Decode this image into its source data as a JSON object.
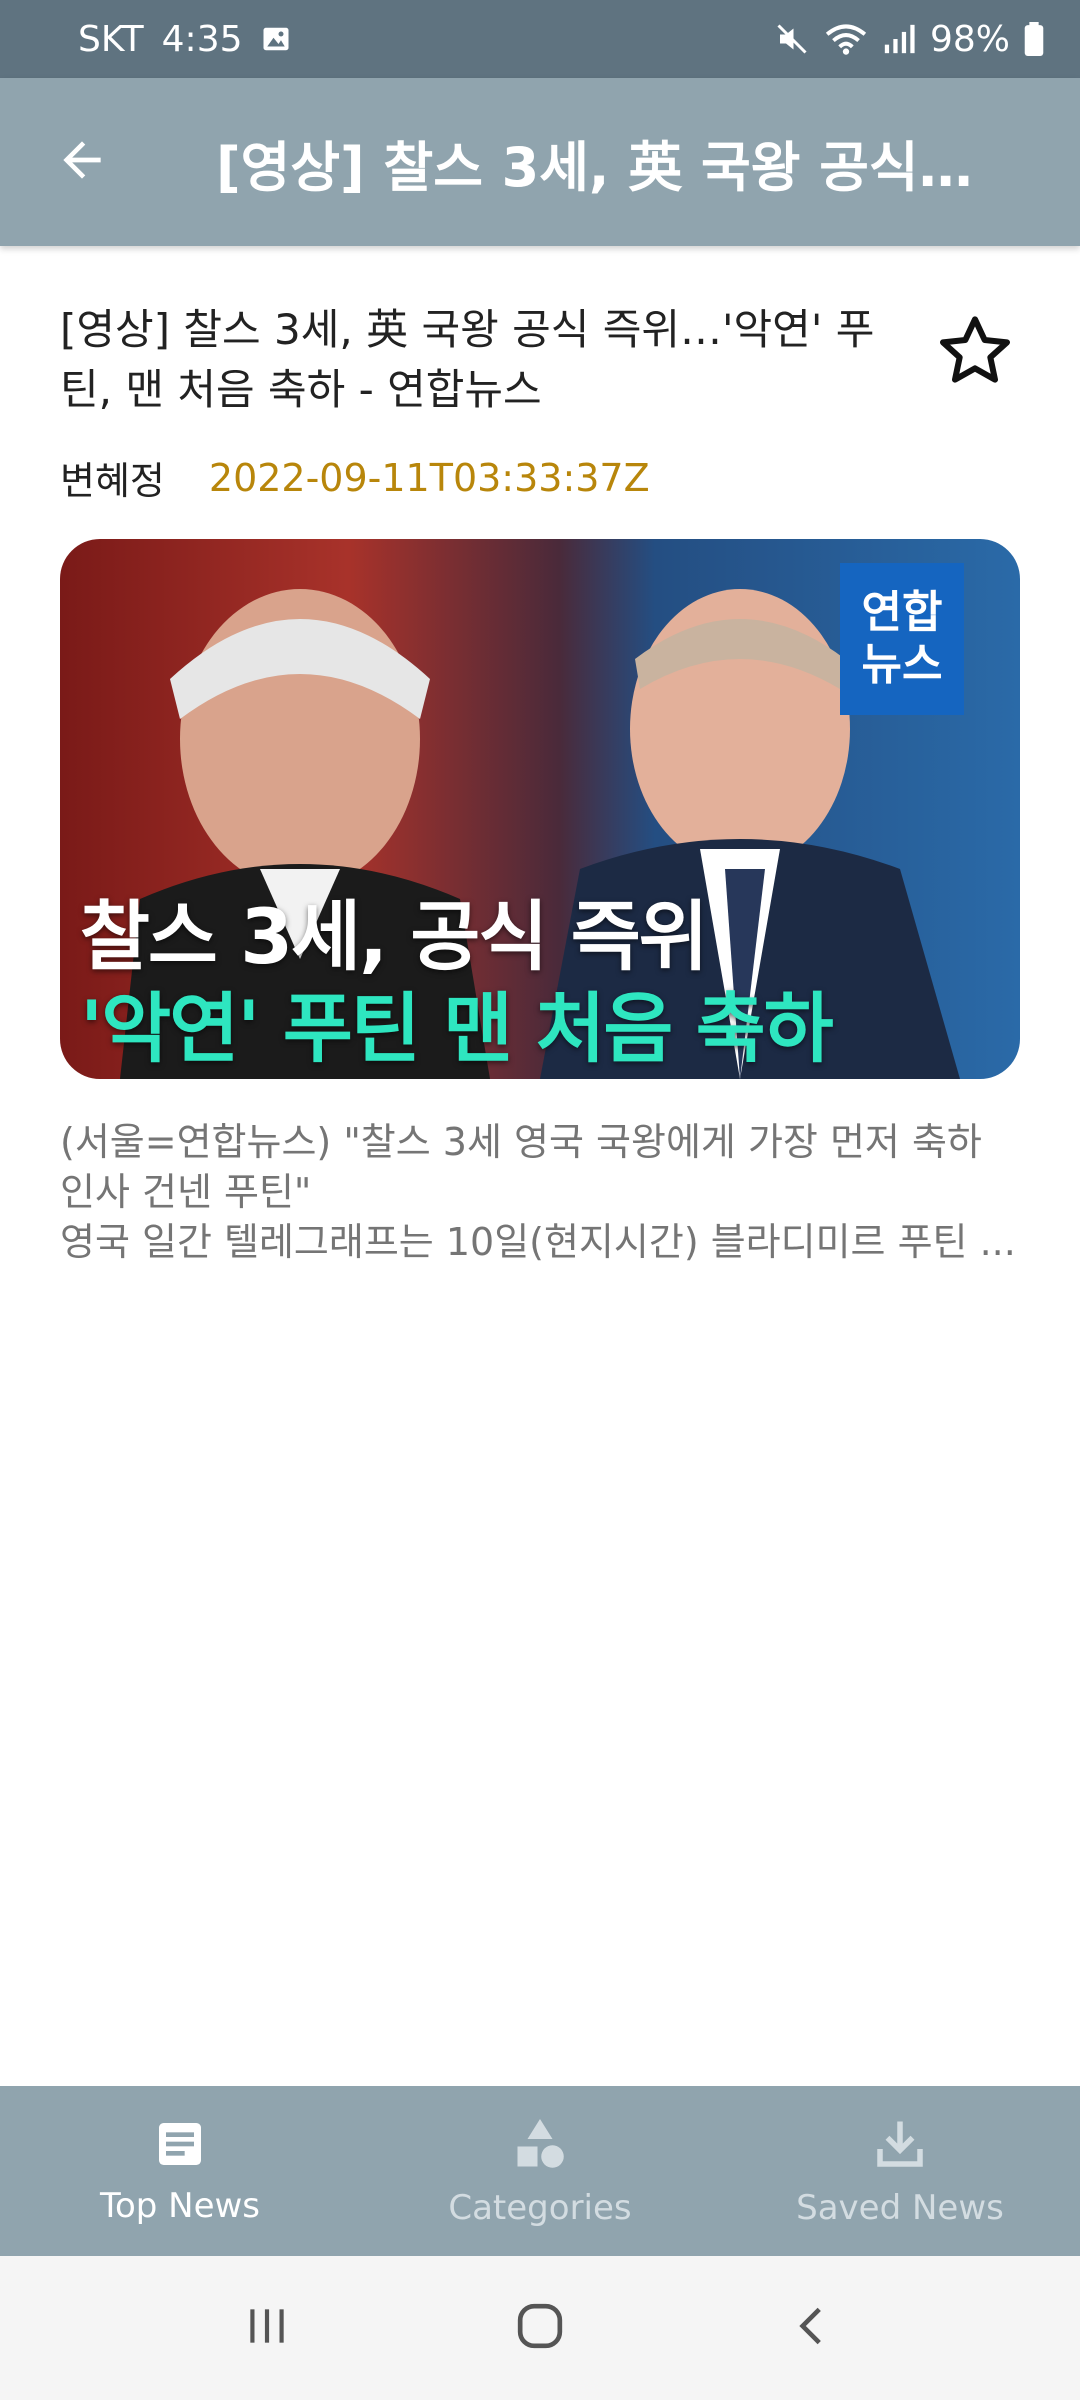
{
  "status_bar": {
    "carrier": "SKT",
    "time": "4:35",
    "battery": "98%",
    "icons": [
      "image-icon",
      "mute-icon",
      "wifi-icon",
      "signal-icon",
      "battery-icon"
    ]
  },
  "app_bar": {
    "title": "[영상] 찰스 3세, 英 국왕 공식…",
    "back_icon": "arrow-back-icon"
  },
  "article": {
    "headline": "[영상] 찰스 3세, 英 국왕 공식 즉위…'악연' 푸틴, 맨 처음 축하 - 연합뉴스",
    "author": "변혜정",
    "published": "2022-09-11T03:33:37Z",
    "thumbnail": {
      "badge": "연합\n뉴스",
      "caption_line1": "찰스 3세, 공식 즉위",
      "caption_line2": "'악연' 푸틴 맨 처음 축하"
    },
    "summary_line1": "(서울=연합뉴스) \"찰스 3세 영국 국왕에게 가장 먼저 축하 인사 건넨 푸틴\"",
    "summary_line2": "영국 일간 텔레그래프는 10일(현지시간) 블라디미르 푸틴 ...",
    "favorite_icon": "star-outline-icon"
  },
  "bottom_nav": {
    "items": [
      {
        "label": "Top News",
        "icon": "article-icon",
        "active": true
      },
      {
        "label": "Categories",
        "icon": "category-icon",
        "active": false
      },
      {
        "label": "Saved News",
        "icon": "download-icon",
        "active": false
      }
    ]
  },
  "colors": {
    "app_bar": "#90a4ae",
    "status_bar": "#5f7380",
    "timestamp": "#b8860b",
    "summary": "#757575"
  }
}
